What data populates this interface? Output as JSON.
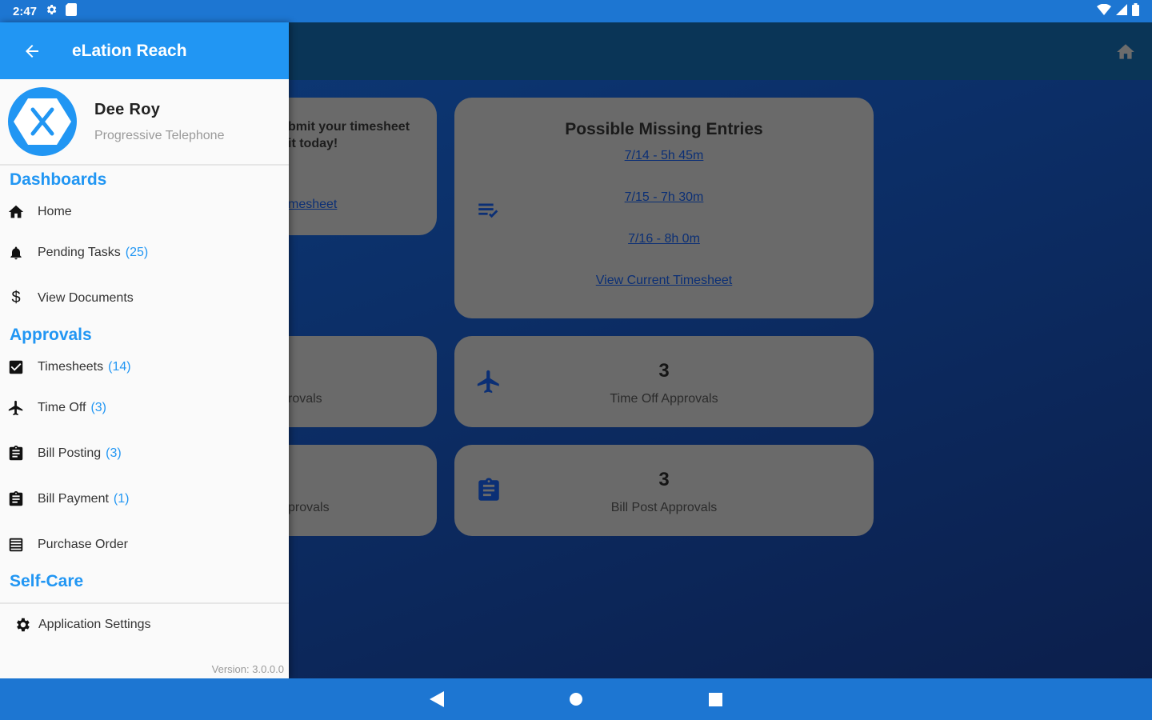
{
  "status_bar": {
    "time": "2:47"
  },
  "drawer": {
    "title": "eLation Reach",
    "profile": {
      "name": "Dee Roy",
      "company": "Progressive Telephone"
    },
    "sections": {
      "dashboards": "Dashboards",
      "approvals": "Approvals",
      "self_care": "Self-Care"
    },
    "items": {
      "home": {
        "label": "Home"
      },
      "pending_tasks": {
        "label": "Pending Tasks",
        "count": "(25)"
      },
      "view_documents": {
        "label": "View Documents"
      },
      "timesheets": {
        "label": "Timesheets",
        "count": "(14)"
      },
      "time_off": {
        "label": "Time Off",
        "count": "(3)"
      },
      "bill_posting": {
        "label": "Bill Posting",
        "count": "(3)"
      },
      "bill_payment": {
        "label": "Bill Payment",
        "count": "(1)"
      },
      "purchase_order": {
        "label": "Purchase Order"
      },
      "app_settings": {
        "label": "Application Settings"
      }
    },
    "version": "Version: 3.0.0.0"
  },
  "main": {
    "submit_card": {
      "line1": "bmit your timesheet",
      "line2": "it today!",
      "link": "mesheet"
    },
    "missing_card": {
      "title": "Possible Missing Entries",
      "entries": [
        "7/14 - 5h 45m",
        "7/15 - 7h 30m",
        "7/16 - 8h 0m"
      ],
      "link": "View Current Timesheet"
    },
    "left_card_2": {
      "text": "rovals"
    },
    "left_card_3": {
      "text": "provals"
    },
    "time_off_card": {
      "count": "3",
      "label": "Time Off Approvals"
    },
    "bill_post_card": {
      "count": "3",
      "label": "Bill Post Approvals"
    }
  },
  "colors": {
    "accent": "#2196f3",
    "status_bar": "#1d76d2",
    "card": "#6a6a6a",
    "toolbar": "#0a3557"
  }
}
